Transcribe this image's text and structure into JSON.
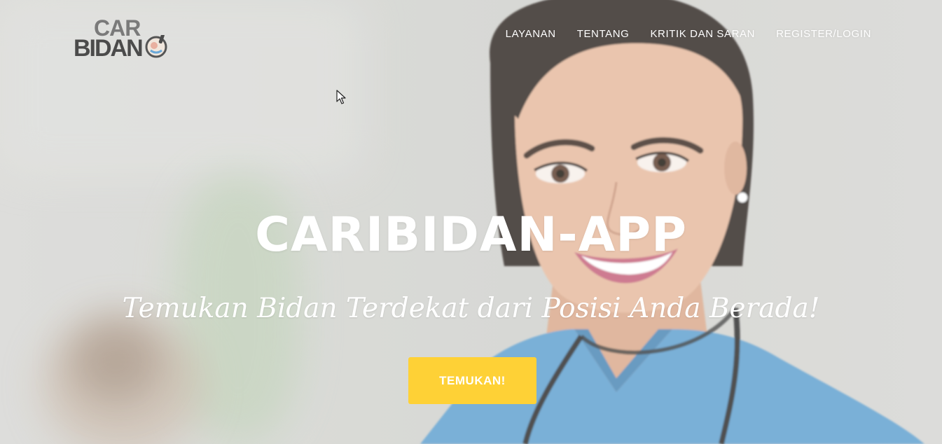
{
  "brand": {
    "logo_line1": "CAR",
    "logo_line2": "BIDAN",
    "logo_emblem": "midwife-emblem-icon"
  },
  "nav": {
    "items": [
      {
        "label": "LAYANAN"
      },
      {
        "label": "TENTANG"
      },
      {
        "label": "KRITIK DAN SARAN"
      },
      {
        "label": "REGISTER/LOGIN"
      }
    ]
  },
  "hero": {
    "title": "CARIBIDAN-APP",
    "subtitle": "Temukan Bidan Terdekat dari Posisi Anda Berada!",
    "cta_label": "TEMUKAN!"
  },
  "colors": {
    "accent": "#fed136",
    "text_light": "#ffffff",
    "scrubs": "#5d9fcf"
  }
}
